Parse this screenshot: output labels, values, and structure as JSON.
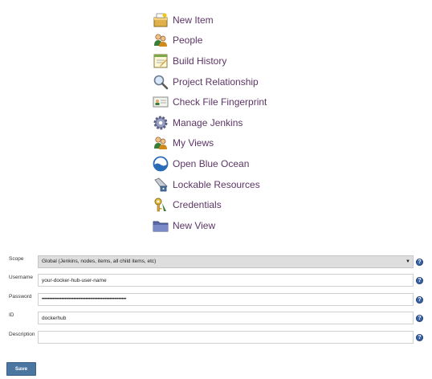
{
  "menu": {
    "items": [
      {
        "label": "New Item",
        "icon": "new-item-icon"
      },
      {
        "label": "People",
        "icon": "people-icon"
      },
      {
        "label": "Build History",
        "icon": "build-history-icon"
      },
      {
        "label": "Project Relationship",
        "icon": "magnifier-icon"
      },
      {
        "label": "Check File Fingerprint",
        "icon": "fingerprint-icon"
      },
      {
        "label": "Manage Jenkins",
        "icon": "gear-icon"
      },
      {
        "label": "My Views",
        "icon": "user-views-icon"
      },
      {
        "label": "Open Blue Ocean",
        "icon": "blue-ocean-icon"
      },
      {
        "label": "Lockable Resources",
        "icon": "lock-icon"
      },
      {
        "label": "Credentials",
        "icon": "key-icon"
      },
      {
        "label": "New View",
        "icon": "folder-icon"
      }
    ]
  },
  "form": {
    "scope": {
      "label": "Scope",
      "value": "Global (Jenkins, nodes, items, all child items, etc)"
    },
    "username": {
      "label": "Username",
      "value": "your-docker-hub-user-name"
    },
    "password": {
      "label": "Password",
      "value": "••••••••••••••••••••••••••••••••••••••••••••••••••••••••"
    },
    "id": {
      "label": "ID",
      "value": "dockerhub"
    },
    "description": {
      "label": "Description",
      "value": ""
    },
    "help_glyph": "?",
    "arrow_glyph": "▼"
  },
  "buttons": {
    "save_label": "Save"
  },
  "colors": {
    "link": "#5c3566",
    "save_button": "#4b76a0",
    "help_icon": "#3a63a6",
    "select_bg": "#dedede"
  }
}
